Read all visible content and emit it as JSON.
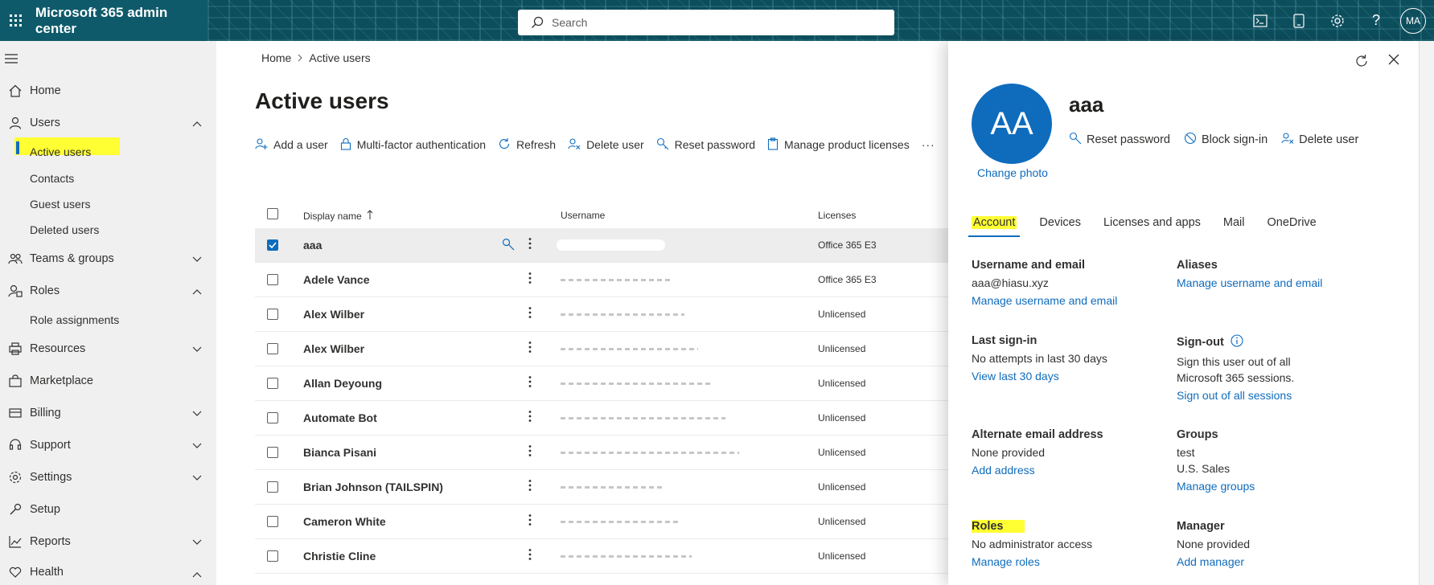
{
  "topbar": {
    "app_title": "Microsoft 365 admin center",
    "search_placeholder": "Search",
    "avatar_initials": "MA"
  },
  "nav": {
    "home": "Home",
    "users": "Users",
    "users_sub": [
      "Active users",
      "Contacts",
      "Guest users",
      "Deleted users"
    ],
    "teams": "Teams & groups",
    "roles": "Roles",
    "roles_sub": [
      "Role assignments"
    ],
    "resources": "Resources",
    "marketplace": "Marketplace",
    "billing": "Billing",
    "support": "Support",
    "settings": "Settings",
    "setup": "Setup",
    "reports": "Reports",
    "health": "Health"
  },
  "main": {
    "breadcrumb": [
      "Home",
      "Active users"
    ],
    "title": "Active users",
    "commands": [
      "Add a user",
      "Multi-factor authentication",
      "Refresh",
      "Delete user",
      "Reset password",
      "Manage product licenses"
    ],
    "columns": {
      "name": "Display name",
      "username": "Username",
      "licenses": "Licenses"
    },
    "rows": [
      {
        "name": "aaa",
        "license": "Office 365 E3",
        "selected": true
      },
      {
        "name": "Adele Vance",
        "license": "Office 365 E3"
      },
      {
        "name": "Alex Wilber",
        "license": "Unlicensed"
      },
      {
        "name": "Alex Wilber",
        "license": "Unlicensed"
      },
      {
        "name": "Allan Deyoung",
        "license": "Unlicensed"
      },
      {
        "name": "Automate Bot",
        "license": "Unlicensed"
      },
      {
        "name": "Bianca Pisani",
        "license": "Unlicensed"
      },
      {
        "name": "Brian Johnson (TAILSPIN)",
        "license": "Unlicensed"
      },
      {
        "name": "Cameron White",
        "license": "Unlicensed"
      },
      {
        "name": "Christie Cline",
        "license": "Unlicensed"
      }
    ]
  },
  "panel": {
    "initials": "AA",
    "name": "aaa",
    "change_photo": "Change photo",
    "actions": [
      "Reset password",
      "Block sign-in",
      "Delete user"
    ],
    "tabs": [
      "Account",
      "Devices",
      "Licenses and apps",
      "Mail",
      "OneDrive"
    ],
    "username_label": "Username and email",
    "username_value": "aaa@hiasu.xyz",
    "username_link": "Manage username and email",
    "aliases_label": "Aliases",
    "aliases_link": "Manage username and email",
    "last_signin_label": "Last sign-in",
    "last_signin_value": "No attempts in last 30 days",
    "last_signin_link": "View last 30 days",
    "signout_label": "Sign-out",
    "signout_value1": "Sign this user out of all",
    "signout_value2": "Microsoft 365 sessions.",
    "signout_link": "Sign out of all sessions",
    "alt_email_label": "Alternate email address",
    "alt_email_value": "None provided",
    "alt_email_link": "Add address",
    "groups_label": "Groups",
    "groups_value1": "test",
    "groups_value2": "U.S. Sales",
    "groups_link": "Manage groups",
    "roles_label": "Roles",
    "roles_value": "No administrator access",
    "roles_link": "Manage roles",
    "manager_label": "Manager",
    "manager_value": "None provided",
    "manager_link": "Add manager"
  }
}
